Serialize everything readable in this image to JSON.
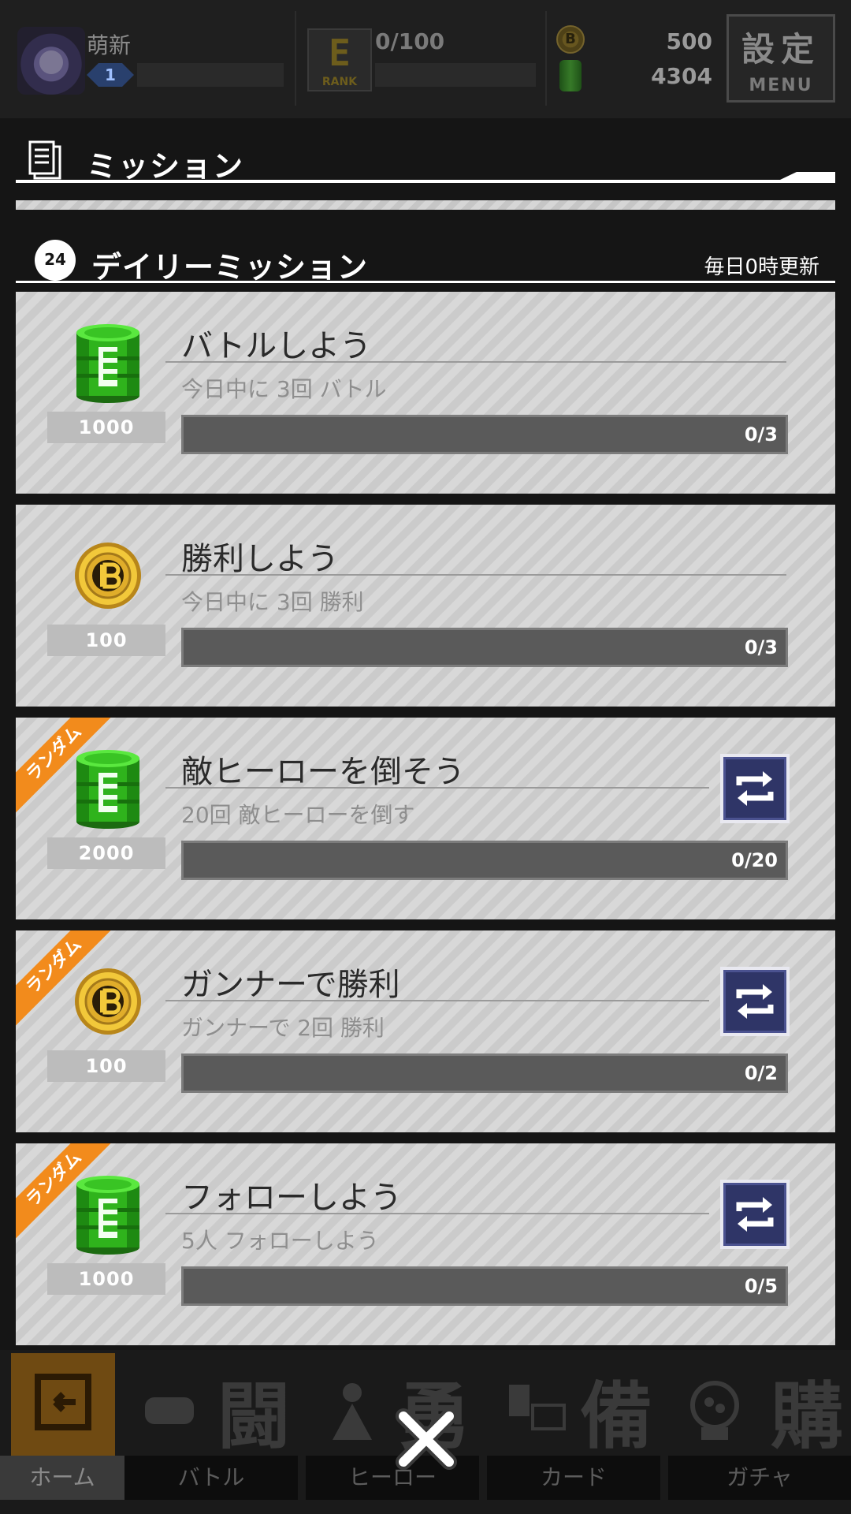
{
  "topbar": {
    "player_name": "萌新",
    "level": "1",
    "rank_glyph": "E",
    "rank_label": "RANK",
    "rank_progress": "0/100",
    "coin_glyph": "B",
    "coin_amount": "500",
    "barrel_amount": "4304",
    "menu_kanji": "設定",
    "menu_label": "MENU"
  },
  "mission": {
    "title": "ミッション"
  },
  "daily": {
    "clock_label": "24",
    "title": "デイリーミッション",
    "reset_note": "毎日0時更新"
  },
  "random_tag": "ランダム",
  "missions": [
    {
      "title": "バトルしよう",
      "desc": "今日中に 3回 バトル",
      "reward_type": "barrel-icon",
      "reward": "1000",
      "progress": "0/3",
      "fraction": 0,
      "random": false
    },
    {
      "title": "勝利しよう",
      "desc": "今日中に 3回 勝利",
      "reward_type": "coin-icon",
      "reward": "100",
      "progress": "0/3",
      "fraction": 0,
      "random": false
    },
    {
      "title": "敵ヒーローを倒そう",
      "desc": "20回 敵ヒーローを倒す",
      "reward_type": "barrel-icon",
      "reward": "2000",
      "progress": "0/20",
      "fraction": 0,
      "random": true
    },
    {
      "title": "ガンナーで勝利",
      "desc": "ガンナーで 2回 勝利",
      "reward_type": "coin-icon",
      "reward": "100",
      "progress": "0/2",
      "fraction": 0,
      "random": true
    },
    {
      "title": "フォローしよう",
      "desc": "5人 フォローしよう",
      "reward_type": "barrel-icon",
      "reward": "1000",
      "progress": "0/5",
      "fraction": 0,
      "random": true
    }
  ],
  "bottom_nav": [
    {
      "label": "ホーム",
      "kanji": ""
    },
    {
      "label": "バトル",
      "kanji": "闘"
    },
    {
      "label": "ヒーロー",
      "kanji": "勇"
    },
    {
      "label": "カード",
      "kanji": "備"
    },
    {
      "label": "ガチャ",
      "kanji": "購"
    }
  ],
  "colors": {
    "accent_orange": "#f28b1c",
    "barrel_green": "#3fd12a",
    "coin_gold": "#e2b62c",
    "refresh_navy": "#2f3567",
    "progress_track": "#5a5a5a"
  }
}
